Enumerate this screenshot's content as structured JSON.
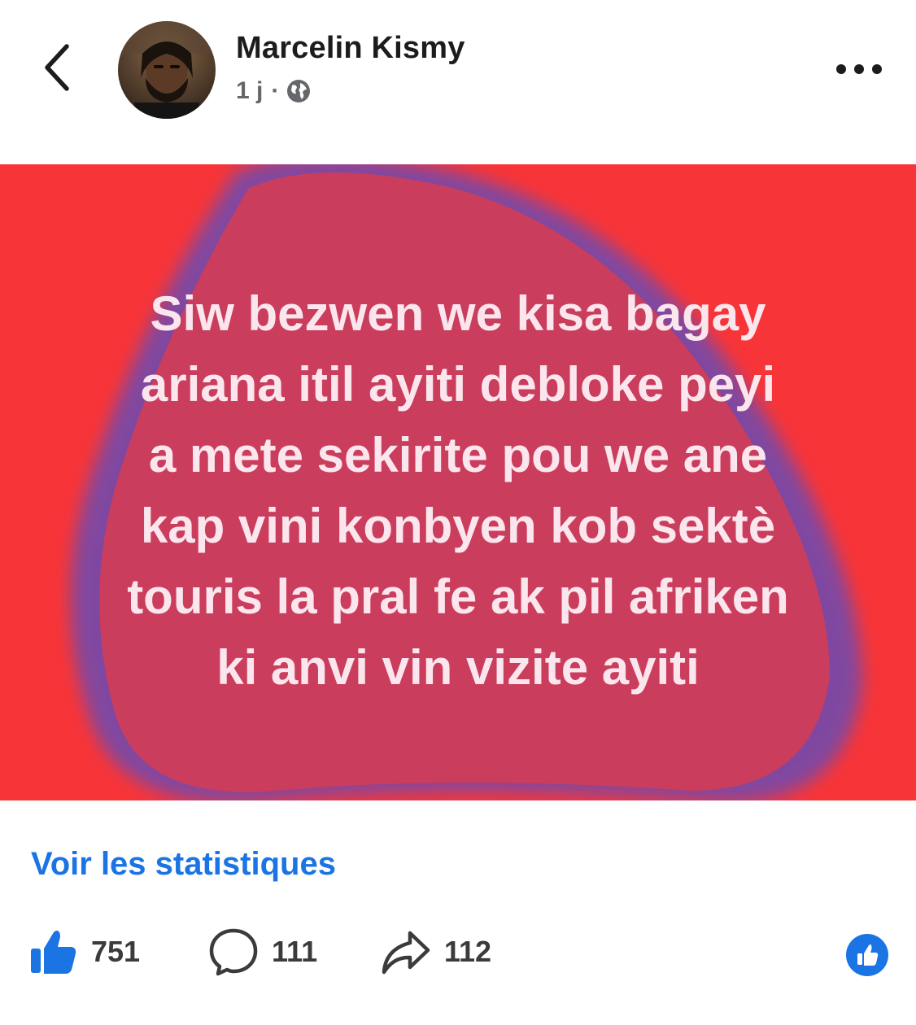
{
  "header": {
    "author_name": "Marcelin Kismy",
    "time_ago": "1 j",
    "separator": "·",
    "audience_icon": "globe-icon",
    "back_icon": "chevron-left-icon",
    "more_icon": "more-horizontal-icon"
  },
  "post": {
    "background_color": "#f73538",
    "blob_color": "#6e4fa8",
    "text_color": "#fbe6ee",
    "text_lines": [
      "Siw bezwen we kisa bagay",
      "ariana itil ayiti debloke peyi",
      "a mete sekirite pou we ane",
      "kap vini konbyen kob sektè",
      "touris la pral fe ak pil afriken",
      "ki anvi vin vizite ayiti"
    ]
  },
  "stats_link": "Voir les statistiques",
  "actions": {
    "likes": "751",
    "comments": "111",
    "shares": "112"
  },
  "colors": {
    "accent": "#1b74e4",
    "text_dark": "#1c1c1e",
    "text_muted": "#65676b"
  }
}
